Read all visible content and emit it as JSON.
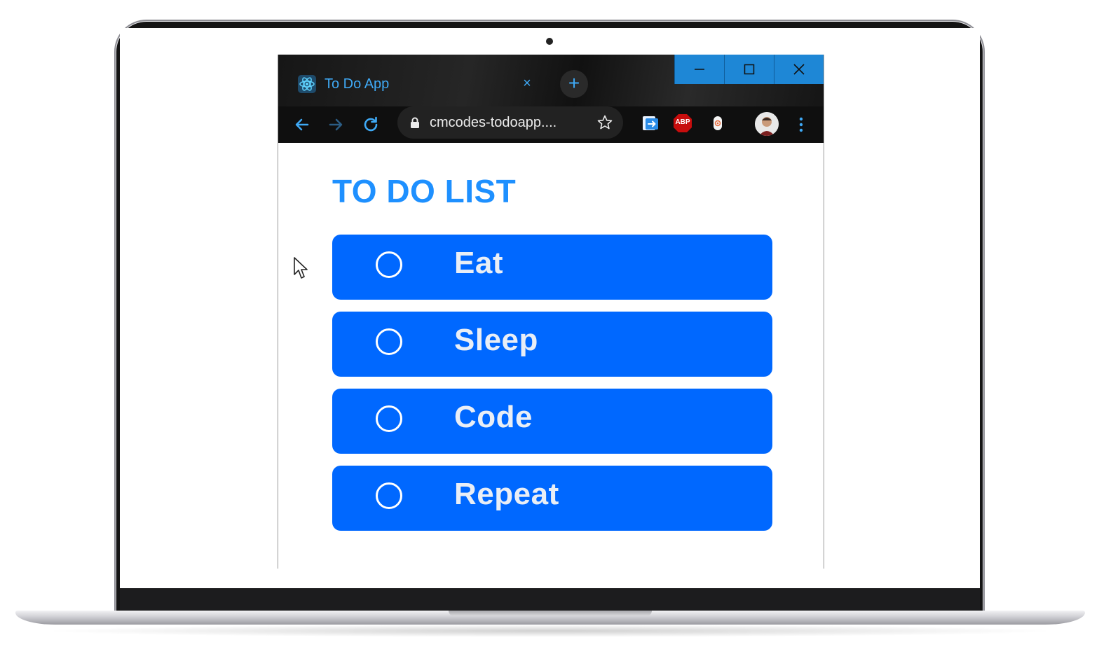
{
  "browser": {
    "tab_title": "To Do App",
    "tab_close": "×",
    "new_tab": "+",
    "url": "cmcodes-todoapp....",
    "extensions": [
      "share-extension-icon",
      "adblock-plus-icon",
      "fingerprint-extension-icon"
    ],
    "extension_label_abp": "ABP"
  },
  "colors": {
    "accent": "#1e90ff",
    "item_bg": "#0068ff",
    "window_controls": "#1e87d6"
  },
  "app": {
    "title": "TO DO LIST",
    "items": [
      {
        "label": "Eat",
        "done": false
      },
      {
        "label": "Sleep",
        "done": false
      },
      {
        "label": "Code",
        "done": false
      },
      {
        "label": "Repeat",
        "done": false
      }
    ]
  }
}
